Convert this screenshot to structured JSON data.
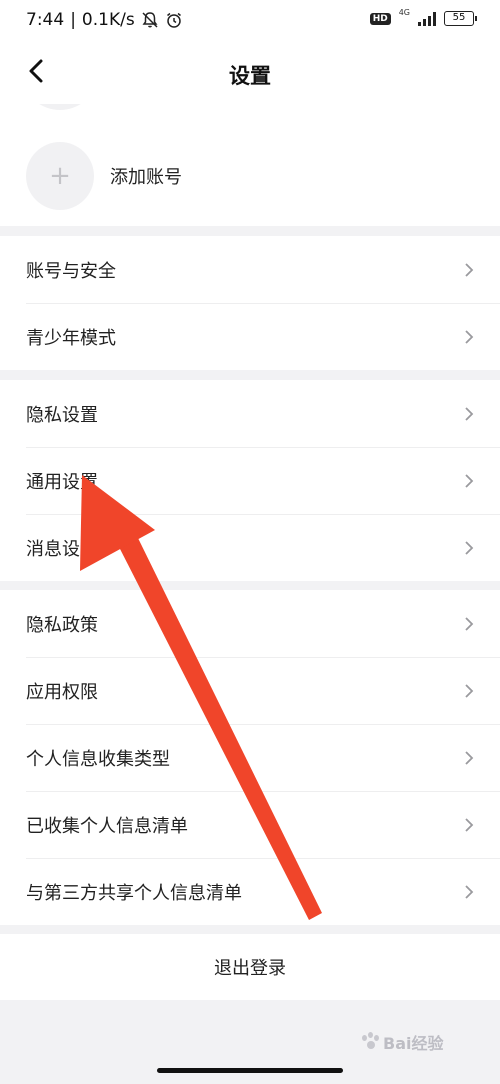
{
  "status_bar": {
    "time": "7:44",
    "speed": "0.1K/s",
    "hd": "HD",
    "network": "4G",
    "battery": "55"
  },
  "nav": {
    "title": "设置"
  },
  "account": {
    "add_label": "添加账号",
    "add_symbol": "+"
  },
  "groups": [
    {
      "items": [
        "账号与安全",
        "青少年模式"
      ]
    },
    {
      "items": [
        "隐私设置",
        "通用设置",
        "消息设置"
      ]
    },
    {
      "items": [
        "隐私政策",
        "应用权限",
        "个人信息收集类型",
        "已收集个人信息清单",
        "与第三方共享个人信息清单"
      ]
    }
  ],
  "logout_label": "退出登录",
  "watermark": "Bai经验",
  "colors": {
    "annotation_arrow": "#f0452a",
    "background": "#f2f2f4",
    "card": "#ffffff"
  },
  "icons": {
    "back": "chevron-left-icon",
    "row": "chevron-right-icon",
    "mute": "bell-off-icon",
    "alarm": "alarm-icon"
  }
}
